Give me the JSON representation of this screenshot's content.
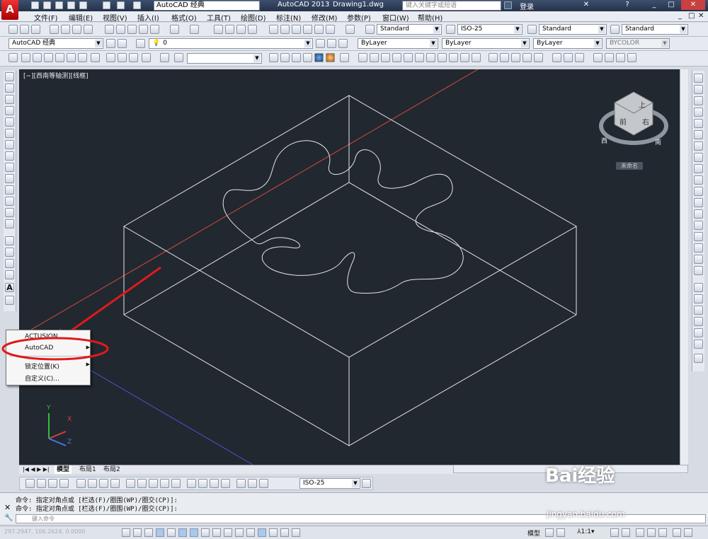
{
  "app": {
    "workspace": "AutoCAD 经典",
    "app_name": "AutoCAD 2013",
    "doc_name": "Drawing1.dwg",
    "search_placeholder": "键入关键字或短语",
    "login": "登录"
  },
  "menus": [
    "文件(F)",
    "编辑(E)",
    "视图(V)",
    "插入(I)",
    "格式(O)",
    "工具(T)",
    "绘图(D)",
    "标注(N)",
    "修改(M)",
    "参数(P)",
    "窗口(W)",
    "帮助(H)"
  ],
  "styles": {
    "text_style": "Standard",
    "dim_style": "ISO-25",
    "table_style": "Standard",
    "multileader_style": "Standard"
  },
  "layers": {
    "workspace_combo": "AutoCAD 经典",
    "layer": "0",
    "color": "ByLayer",
    "linetype": "ByLayer",
    "lineweight": "ByLayer",
    "plotstyle": "BYCOLOR"
  },
  "viewport": {
    "label": "[−][西南等轴测][线框]",
    "viewcube_top": "上",
    "viewcube_front": "前",
    "viewcube_right": "右",
    "compass_west": "西",
    "compass_south": "南",
    "viewcube_tag": "未命名"
  },
  "context_menu": {
    "items": [
      {
        "label": "ACTUSION",
        "submenu": false
      },
      {
        "label": "AutoCAD",
        "submenu": true
      },
      {
        "label": "锁定位置(K)",
        "submenu": true
      },
      {
        "label": "自定义(C)...",
        "submenu": false
      }
    ]
  },
  "ucs": {
    "x": "X",
    "y": "Y",
    "z": "Z"
  },
  "layout_tabs": [
    "模型",
    "布局1",
    "布局2"
  ],
  "snapbar": {
    "dim_style": "ISO-25"
  },
  "command": {
    "history": [
      "命令: 指定对角点或 [栏选(F)/圈围(WP)/圈交(CP)]:",
      "命令: 指定对角点或 [栏选(F)/圈围(WP)/圈交(CP)]:"
    ],
    "placeholder": "键入命令"
  },
  "status": {
    "coords": "297.2947, 106.2624, 0.0000",
    "model": "模型",
    "scale": "1:1"
  },
  "watermark": {
    "text": "Bai经验",
    "url": "jingyan.baidu.com"
  },
  "colors": {
    "background": "#212830",
    "annotation": "#e0191c",
    "wire": "#e6e6e6"
  }
}
